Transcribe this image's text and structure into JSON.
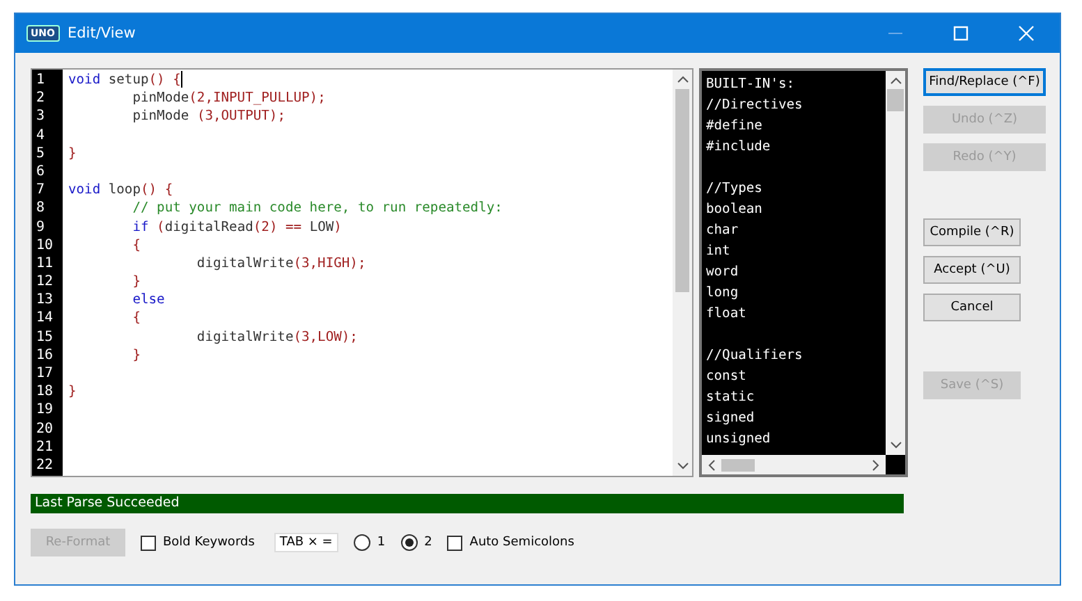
{
  "window": {
    "title": "Edit/View",
    "app_badge": "UNO"
  },
  "editor": {
    "lines": [
      {
        "number": "1",
        "segments": [
          {
            "kind": "keyword",
            "text": "void"
          },
          {
            "kind": "plain",
            "text": " setup"
          },
          {
            "kind": "punct",
            "text": "() {"
          }
        ],
        "cursor": true
      },
      {
        "number": "2",
        "segments": [
          {
            "kind": "plain",
            "text": "\tpinMode"
          },
          {
            "kind": "punct",
            "text": "(2,INPUT_PULLUP);"
          }
        ]
      },
      {
        "number": "3",
        "segments": [
          {
            "kind": "plain",
            "text": "\tpinMode "
          },
          {
            "kind": "punct",
            "text": "(3,OUTPUT);"
          }
        ]
      },
      {
        "number": "4"
      },
      {
        "number": "5",
        "segments": [
          {
            "kind": "punct",
            "text": "}"
          }
        ]
      },
      {
        "number": "6"
      },
      {
        "number": "7",
        "segments": [
          {
            "kind": "keyword",
            "text": "void"
          },
          {
            "kind": "plain",
            "text": " loop"
          },
          {
            "kind": "punct",
            "text": "() {"
          }
        ]
      },
      {
        "number": "8",
        "segments": [
          {
            "kind": "comment",
            "text": "\t// put your main code here, to run repeatedly:"
          }
        ]
      },
      {
        "number": "9",
        "segments": [
          {
            "kind": "keyword",
            "text": "\tif"
          },
          {
            "kind": "punct",
            "text": " ("
          },
          {
            "kind": "plain",
            "text": "digitalRead"
          },
          {
            "kind": "punct",
            "text": "(2) == "
          },
          {
            "kind": "plain",
            "text": "LOW"
          },
          {
            "kind": "punct",
            "text": ")"
          }
        ]
      },
      {
        "number": "10",
        "segments": [
          {
            "kind": "punct",
            "text": "\t{"
          }
        ]
      },
      {
        "number": "11",
        "segments": [
          {
            "kind": "plain",
            "text": "\t\tdigitalWrite"
          },
          {
            "kind": "punct",
            "text": "(3,HIGH);"
          }
        ]
      },
      {
        "number": "12",
        "segments": [
          {
            "kind": "punct",
            "text": "\t}"
          }
        ]
      },
      {
        "number": "13",
        "segments": [
          {
            "kind": "keyword",
            "text": "\telse"
          }
        ]
      },
      {
        "number": "14",
        "segments": [
          {
            "kind": "punct",
            "text": "\t{"
          }
        ]
      },
      {
        "number": "15",
        "segments": [
          {
            "kind": "plain",
            "text": "\t\tdigitalWrite"
          },
          {
            "kind": "punct",
            "text": "(3,LOW);"
          }
        ]
      },
      {
        "number": "16",
        "segments": [
          {
            "kind": "punct",
            "text": "\t}"
          }
        ]
      },
      {
        "number": "17"
      },
      {
        "number": "18",
        "segments": [
          {
            "kind": "punct",
            "text": "}"
          }
        ]
      },
      {
        "number": "19"
      },
      {
        "number": "20"
      },
      {
        "number": "21"
      },
      {
        "number": "22"
      }
    ]
  },
  "builtins": {
    "groups": [
      [
        "BUILT-IN's:",
        "//Directives",
        "#define",
        "#include"
      ],
      [
        "//Types",
        "boolean",
        "char",
        "int",
        "word",
        "long",
        "float"
      ],
      [
        "//Qualifiers",
        "const",
        "static",
        "signed",
        "unsigned"
      ]
    ]
  },
  "side_buttons": [
    {
      "label": "Find/Replace (^F)",
      "disabled": false,
      "focused": true
    },
    {
      "label": "Undo (^Z)",
      "disabled": true,
      "focused": false
    },
    {
      "label": "Redo (^Y)",
      "disabled": true,
      "focused": false
    },
    {
      "label": "Compile (^R)",
      "disabled": false,
      "focused": false
    },
    {
      "label": "Accept (^U)",
      "disabled": false,
      "focused": false
    },
    {
      "label": "Cancel",
      "disabled": false,
      "focused": false
    },
    {
      "label": "Save (^S)",
      "disabled": true,
      "focused": false
    }
  ],
  "status": {
    "text": "Last Parse Succeeded"
  },
  "options": {
    "reformat": {
      "label": "Re-Format",
      "disabled": true
    },
    "bold_keywords": {
      "label": "Bold Keywords",
      "checked": false
    },
    "tab_label": "TAB × =",
    "tab_sizes": [
      {
        "label": "1",
        "selected": false
      },
      {
        "label": "2",
        "selected": true
      }
    ],
    "auto_semicolons": {
      "label": "Auto Semicolons",
      "checked": false
    }
  }
}
